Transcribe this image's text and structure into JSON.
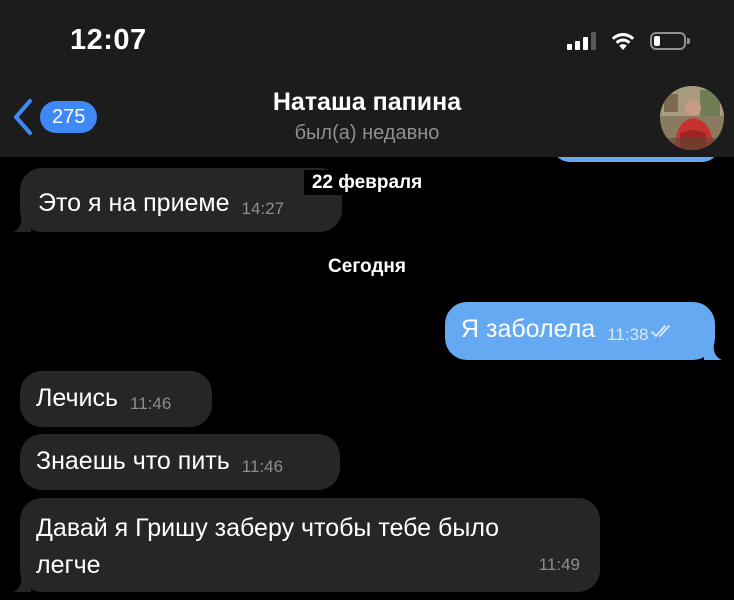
{
  "status_bar": {
    "time": "12:07",
    "icons": [
      "cellular-signal-icon",
      "wifi-icon",
      "battery-icon"
    ],
    "battery_level": 0.2
  },
  "header": {
    "back_badge": "275",
    "title": "Наташа папина",
    "subtitle": "был(а) недавно"
  },
  "date_separators": {
    "earlier": "22 февраля",
    "today": "Сегодня"
  },
  "messages": [
    {
      "direction": "in",
      "text": "Это я на приеме",
      "time": "14:27"
    },
    {
      "direction": "out",
      "text": "Я заболела",
      "time": "11:38",
      "status": "read"
    },
    {
      "direction": "in",
      "text": "Лечись",
      "time": "11:46"
    },
    {
      "direction": "in",
      "text": "Знаешь что пить",
      "time": "11:46"
    },
    {
      "direction": "in",
      "text": "Давай я Гришу заберу чтобы тебе было легче",
      "time": "11:49"
    }
  ],
  "colors": {
    "accent": "#3e88f7",
    "outgoing_bubble": "#64a9f2",
    "incoming_bubble": "#262628",
    "header_bg": "#1c1c1d",
    "secondary_text": "#8e8e93"
  }
}
